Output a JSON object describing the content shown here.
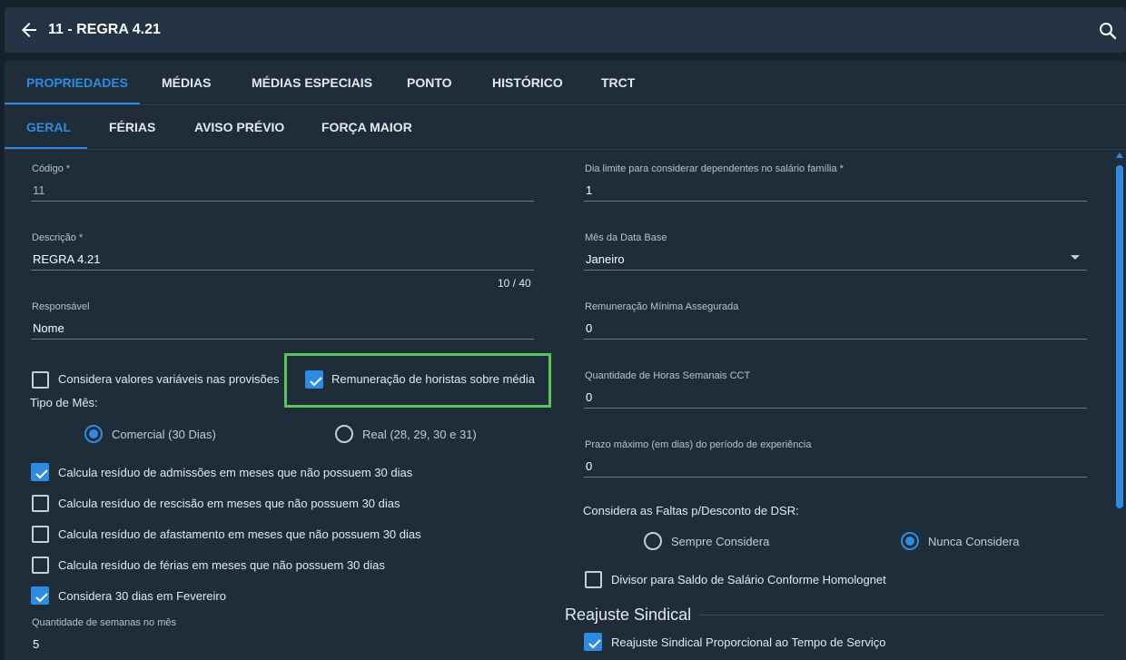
{
  "header": {
    "title": "11 - REGRA 4.21"
  },
  "tabs_main": [
    {
      "label": "PROPRIEDADES"
    },
    {
      "label": "MÉDIAS"
    },
    {
      "label": "MÉDIAS ESPECIAIS"
    },
    {
      "label": "PONTO"
    },
    {
      "label": "HISTÓRICO"
    },
    {
      "label": "TRCT"
    }
  ],
  "tabs_sub": [
    {
      "label": "GERAL"
    },
    {
      "label": "FÉRIAS"
    },
    {
      "label": "AVISO PRÉVIO"
    },
    {
      "label": "FORÇA MAIOR"
    }
  ],
  "left": {
    "codigo": {
      "label": "Código *",
      "value": "11"
    },
    "descricao": {
      "label": "Descrição *",
      "value": "REGRA 4.21",
      "counter": "10 / 40"
    },
    "responsavel": {
      "label": "Responsável",
      "value": "Nome"
    },
    "cb_variaveis": {
      "label": "Considera valores variáveis nas provisões"
    },
    "cb_horistas": {
      "label": "Remuneração de horistas sobre média"
    },
    "tipo_mes": {
      "label": "Tipo de Mês:",
      "options": [
        "Comercial (30 Dias)",
        "Real (28, 29, 30 e 31)"
      ],
      "selected": "Comercial (30 Dias)"
    },
    "checks": [
      {
        "label": "Calcula resíduo de admissões em meses que não possuem 30 dias"
      },
      {
        "label": "Calcula resíduo de rescisão em meses que não possuem 30 dias"
      },
      {
        "label": "Calcula resíduo de afastamento em meses que não possuem 30 dias"
      },
      {
        "label": "Calcula resíduo de férias em meses que não possuem 30 dias"
      },
      {
        "label": "Considera 30 dias em Fevereiro"
      }
    ],
    "semanas": {
      "label": "Quantidade de semanas no mês",
      "value": "5"
    }
  },
  "right": {
    "dia_limite": {
      "label": "Dia limite para considerar dependentes no salário família *",
      "value": "1"
    },
    "mes_base": {
      "label": "Mês da Data Base",
      "value": "Janeiro"
    },
    "remuneracao_min": {
      "label": "Remuneração Mínima Assegurada",
      "value": "0"
    },
    "horas_cct": {
      "label": "Quantidade de Horas Semanais CCT",
      "value": "0"
    },
    "prazo_exp": {
      "label": "Prazo máximo (em dias) do período de experiência",
      "value": "0"
    },
    "faltas_dsr": {
      "label": "Considera as Faltas p/Desconto de DSR:",
      "options": [
        "Sempre Considera",
        "Nunca Considera"
      ],
      "selected": "Nunca Considera"
    },
    "cb_divisor": {
      "label": "Divisor para Saldo de Salário Conforme Homolognet"
    },
    "reajuste": {
      "heading": "Reajuste Sindical",
      "cb_proporcional": {
        "label": "Reajuste Sindical Proporcional ao Tempo de Serviço"
      }
    }
  },
  "colors": {
    "accent": "#2f8be0",
    "highlight": "#5cc25a",
    "background": "#17212b",
    "panel": "#1f2d3b"
  }
}
